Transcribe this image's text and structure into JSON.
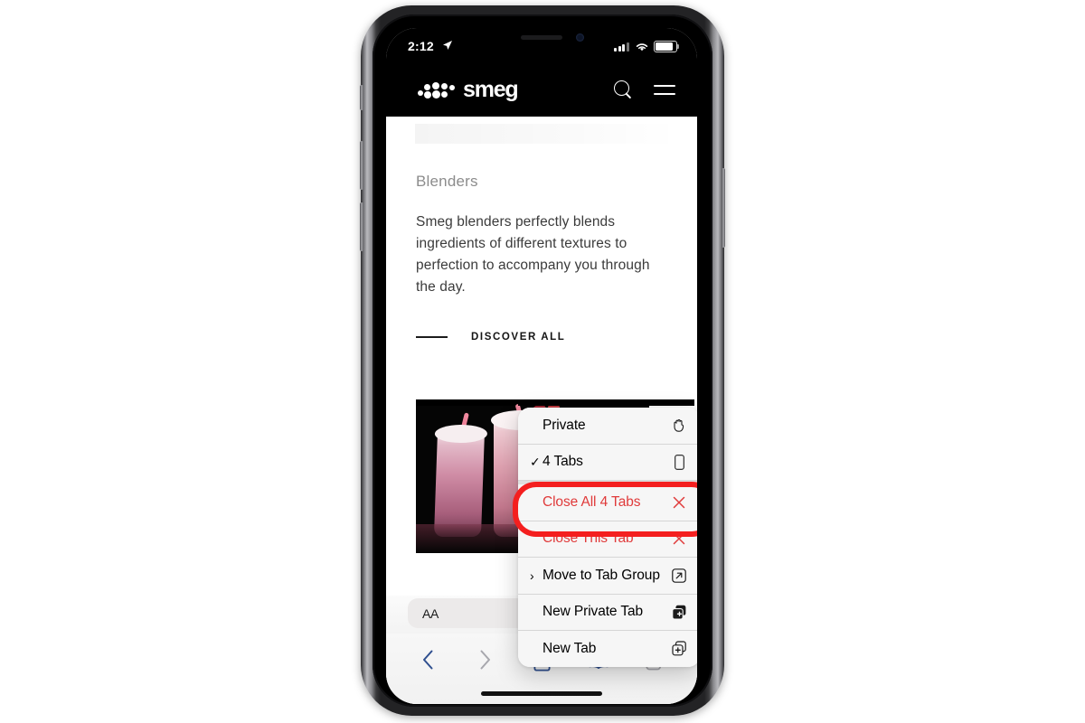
{
  "status_bar": {
    "time": "2:12",
    "location_icon": "location-arrow-icon",
    "cellular_icon": "cellular-bars-icon",
    "wifi_icon": "wifi-icon",
    "battery_icon": "battery-full-icon"
  },
  "site_header": {
    "brand": "smeg",
    "search_icon": "search-icon",
    "menu_icon": "hamburger-menu-icon"
  },
  "page": {
    "section_title": "Blenders",
    "body_text": "Smeg blenders perfectly blends ingredients of different textures to perfection to accompany you through the day.",
    "cta_label": "DISCOVER ALL"
  },
  "context_menu": {
    "items": [
      {
        "label": "Private",
        "icon": "hand-raised-icon",
        "leading": "",
        "destructive": false
      },
      {
        "label": "4 Tabs",
        "icon": "iphone-icon",
        "leading": "✓",
        "destructive": false
      },
      {
        "label": "Close All 4 Tabs",
        "icon": "xmark-icon",
        "leading": "",
        "destructive": true
      },
      {
        "label": "Close This Tab",
        "icon": "xmark-icon",
        "leading": "",
        "destructive": true
      },
      {
        "label": "Move to Tab Group",
        "icon": "arrow-up-right-box-icon",
        "leading": "›",
        "destructive": false
      },
      {
        "label": "New Private Tab",
        "icon": "plus-square-filled-icon",
        "leading": "",
        "destructive": false
      },
      {
        "label": "New Tab",
        "icon": "plus-square-icon",
        "leading": "",
        "destructive": false
      }
    ],
    "highlighted_item": "Close All 4 Tabs",
    "highlight_color": "#f41f1f",
    "destructive_color": "#e03a3a"
  },
  "browser_chrome": {
    "format_button_label": "AA",
    "back_icon": "chevron-left-icon",
    "forward_icon": "chevron-right-icon",
    "share_icon": "share-up-icon",
    "bookmarks_icon": "book-icon",
    "tabs_icon": "tabs-overview-icon",
    "accent_color": "#2f4f8f",
    "disabled_color": "#a7a7ad"
  }
}
